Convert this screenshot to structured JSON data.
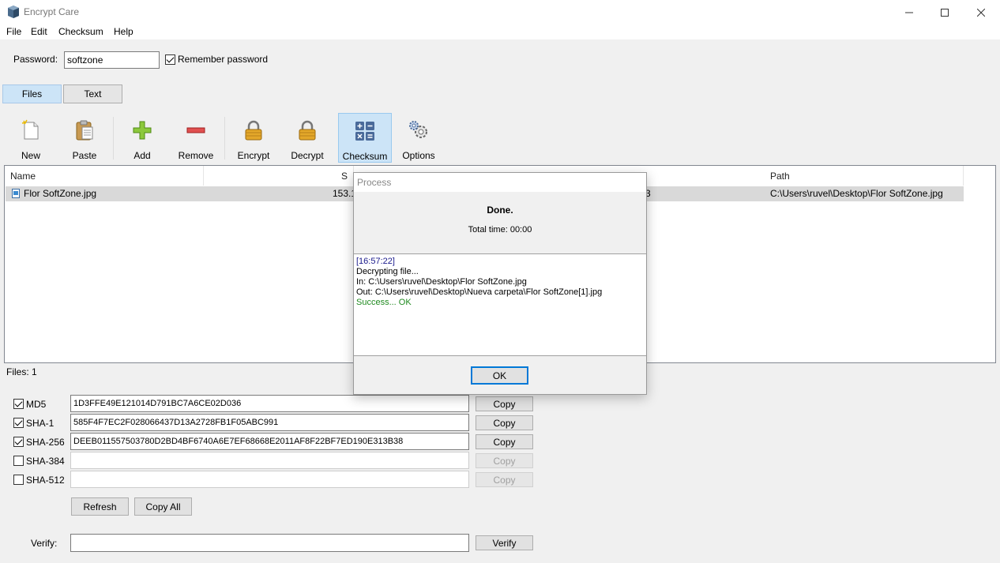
{
  "window": {
    "title": "Encrypt Care"
  },
  "menu": [
    "File",
    "Edit",
    "Checksum",
    "Help"
  ],
  "password": {
    "label": "Password:",
    "value": "softzone",
    "remember_label": "Remember password",
    "remember_checked": true
  },
  "tabs": [
    "Files",
    "Text"
  ],
  "toolbar": [
    {
      "label": "New",
      "icon": "new-file-icon"
    },
    {
      "label": "Paste",
      "icon": "paste-icon"
    },
    {
      "label": "Add",
      "icon": "add-plus-icon"
    },
    {
      "label": "Remove",
      "icon": "remove-minus-icon"
    },
    {
      "label": "Encrypt",
      "icon": "lock-icon"
    },
    {
      "label": "Decrypt",
      "icon": "unlock-icon"
    },
    {
      "label": "Checksum",
      "icon": "calculator-icon"
    },
    {
      "label": "Options",
      "icon": "gears-icon"
    }
  ],
  "file_list": {
    "columns": [
      "Name",
      "S",
      "Path"
    ],
    "rows": [
      {
        "name": "Flor SoftZone.jpg",
        "size": "153.1",
        "modified_partial": "3",
        "path": "C:\\Users\\ruvel\\Desktop\\Flor SoftZone.jpg"
      }
    ]
  },
  "files_count": "Files: 1",
  "hashes": [
    {
      "label": "MD5",
      "checked": true,
      "value": "1D3FFE49E121014D791BC7A6CE02D036",
      "copy": "Copy",
      "enabled": true
    },
    {
      "label": "SHA-1",
      "checked": true,
      "value": "585F4F7EC2F028066437D13A2728FB1F05ABC991",
      "copy": "Copy",
      "enabled": true
    },
    {
      "label": "SHA-256",
      "checked": true,
      "value": "DEEB011557503780D2BD4BF6740A6E7EF68668E2011AF8F22BF7ED190E313B38",
      "copy": "Copy",
      "enabled": true
    },
    {
      "label": "SHA-384",
      "checked": false,
      "value": "",
      "copy": "Copy",
      "enabled": false
    },
    {
      "label": "SHA-512",
      "checked": false,
      "value": "",
      "copy": "Copy",
      "enabled": false
    }
  ],
  "buttons": {
    "refresh": "Refresh",
    "copy_all": "Copy All",
    "verify": "Verify"
  },
  "verify": {
    "label": "Verify:",
    "value": ""
  },
  "dialog": {
    "title": "Process",
    "status": "Done.",
    "total_time": "Total time: 00:00",
    "log": [
      "[16:57:22]",
      "Decrypting file...",
      "In: C:\\Users\\ruvel\\Desktop\\Flor SoftZone.jpg",
      "Out: C:\\Users\\ruvel\\Desktop\\Nueva carpeta\\Flor SoftZone[1].jpg",
      "Success... OK"
    ],
    "ok": "OK"
  }
}
